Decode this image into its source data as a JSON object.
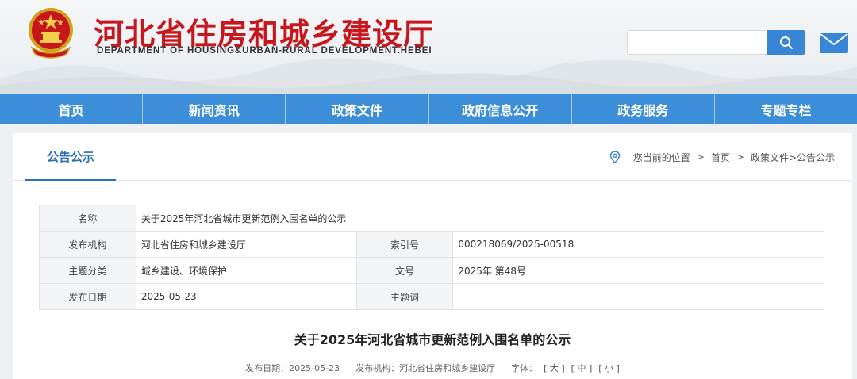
{
  "header": {
    "site_title": "河北省住房和城乡建设厅",
    "site_subtitle": "DEPARTMENT OF HOUSING&URBAN-RURAL DEVELOPMENT.HEBEI",
    "search_placeholder": "",
    "search_icon": "search-icon",
    "mail_icon": "mail-icon",
    "emblem_icon": "national-emblem-icon"
  },
  "nav": {
    "items": [
      {
        "label": "首页"
      },
      {
        "label": "新闻资讯"
      },
      {
        "label": "政策文件"
      },
      {
        "label": "政府信息公开"
      },
      {
        "label": "政务服务"
      },
      {
        "label": "专题专栏"
      }
    ]
  },
  "section": {
    "tab_label": "公告公示",
    "location_icon": "location-pin-icon",
    "breadcrumb": {
      "you_are_here": "您当前的位置",
      "sep": ">",
      "home": "首页",
      "current": "政策文件>公告公示"
    }
  },
  "info": {
    "name_label": "名称",
    "name_value": "关于2025年河北省城市更新范例入围名单的公示",
    "publisher_label": "发布机构",
    "publisher_value": "河北省住房和城乡建设厅",
    "index_label": "索引号",
    "index_value": "000218069/2025-00518",
    "category_label": "主题分类",
    "category_value": "城乡建设、环境保护",
    "doc_no_label": "文号",
    "doc_no_value": "2025年 第48号",
    "date_label": "发布日期",
    "date_value": "2025-05-23",
    "keywords_label": "主题词",
    "keywords_value": ""
  },
  "article": {
    "title": "关于2025年河北省城市更新范例入围名单的公示",
    "meta_date": "发布日期：2025-05-23",
    "meta_publisher": "发布机构：河北省住房和城乡建设厅",
    "font_label": "字体：",
    "font_large": "[ 大 ]",
    "font_medium": "[ 中 ]",
    "font_small": "[ 小 ]"
  },
  "colors": {
    "brand_red": "#c8161d",
    "nav_blue": "#3d8ed8",
    "accent_blue": "#2b6fb9"
  }
}
